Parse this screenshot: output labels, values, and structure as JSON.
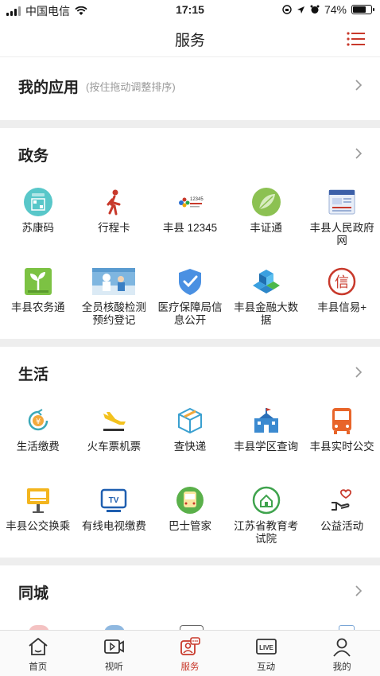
{
  "status_bar": {
    "carrier": "中国电信",
    "time": "17:15",
    "battery": "74%",
    "battery_level": 0.74
  },
  "header": {
    "title": "服务"
  },
  "my_apps": {
    "title": "我的应用",
    "hint": "(按住拖动调整排序)"
  },
  "sections": [
    {
      "title": "政务",
      "apps": [
        {
          "label": "苏康码",
          "icon": "health-code-icon"
        },
        {
          "label": "行程卡",
          "icon": "walking-person-icon"
        },
        {
          "label": "丰县 12345",
          "icon": "hotline-12345-icon"
        },
        {
          "label": "丰证通",
          "icon": "leaf-certificate-icon"
        },
        {
          "label": "丰县人民政府网",
          "icon": "gov-website-icon"
        },
        {
          "label": "丰县农务通",
          "icon": "sprout-icon"
        },
        {
          "label": "全员核酸检测预约登记",
          "icon": "nucleic-test-icon"
        },
        {
          "label": "医疗保障局信息公开",
          "icon": "shield-check-icon"
        },
        {
          "label": "丰县金融大数据",
          "icon": "data-cubes-icon"
        },
        {
          "label": "丰县信易+",
          "icon": "credit-seal-icon"
        }
      ]
    },
    {
      "title": "生活",
      "apps": [
        {
          "label": "生活缴费",
          "icon": "yuan-payment-icon"
        },
        {
          "label": "火车票机票",
          "icon": "airplane-icon"
        },
        {
          "label": "查快递",
          "icon": "package-box-icon"
        },
        {
          "label": "丰县学区查询",
          "icon": "school-building-icon"
        },
        {
          "label": "丰县实时公交",
          "icon": "bus-icon"
        },
        {
          "label": "丰县公交换乘",
          "icon": "bus-stop-sign-icon"
        },
        {
          "label": "有线电视缴费",
          "icon": "tv-icon"
        },
        {
          "label": "巴士管家",
          "icon": "bus-butler-icon"
        },
        {
          "label": "江苏省教育考试院",
          "icon": "education-exam-icon"
        },
        {
          "label": "公益活动",
          "icon": "heart-hand-icon"
        }
      ]
    },
    {
      "title": "同城"
    }
  ],
  "tabs": [
    {
      "label": "首页",
      "icon": "home-icon"
    },
    {
      "label": "视听",
      "icon": "video-play-icon"
    },
    {
      "label": "服务",
      "icon": "service-chat-icon",
      "active": true
    },
    {
      "label": "互动",
      "icon": "live-icon"
    },
    {
      "label": "我的",
      "icon": "user-icon"
    }
  ],
  "colors": {
    "accent": "#c8392b",
    "separator": "#eeeeee",
    "text": "#222222",
    "hint": "#999999"
  }
}
